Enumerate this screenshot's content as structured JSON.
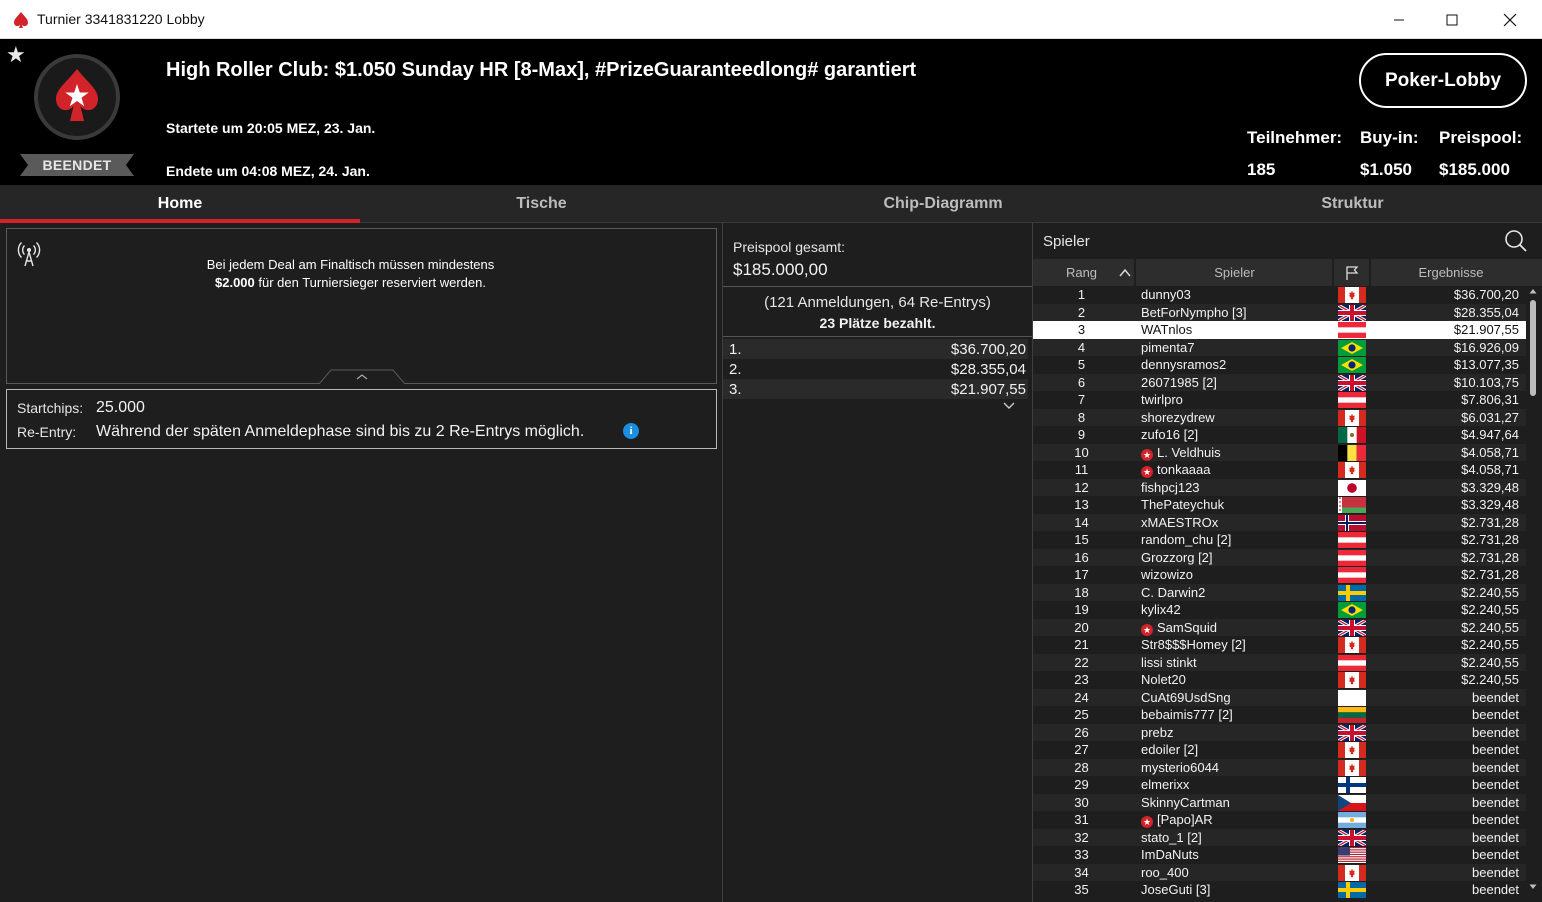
{
  "window": {
    "title": "Turnier 3341831220 Lobby"
  },
  "header": {
    "tournament_name": "High Roller Club: $1.050 Sunday HR [8-Max], #PrizeGuaranteedlong# garantiert",
    "started": "Startete um 20:05 MEZ, 23. Jan.",
    "ended": "Endete um 04:08 MEZ, 24. Jan.",
    "status": "BEENDET",
    "lobby_button": "Poker-Lobby",
    "stats": [
      {
        "label": "Teilnehmer:",
        "value": "185"
      },
      {
        "label": "Buy-in:",
        "value": "$1.050"
      },
      {
        "label": "Preispool:",
        "value": "$185.000"
      }
    ]
  },
  "tabs": [
    "Home",
    "Tische",
    "Chip-Diagramm",
    "Struktur"
  ],
  "active_tab": "Home",
  "home": {
    "notice_line1": "Bei jedem Deal am Finaltisch müssen mindestens",
    "notice_amount": "$2.000",
    "notice_line2_rest": " für den Turniersieger reserviert werden.",
    "startchips_label": "Startchips:",
    "startchips_value": "25.000",
    "reentry_label": "Re-Entry:",
    "reentry_value": "Während der späten Anmeldephase sind bis zu 2 Re-Entrys möglich.",
    "info_icon": "i"
  },
  "prizepool": {
    "label": "Preispool gesamt:",
    "value": "$185.000,00",
    "registrations": "(121 Anmeldungen, 64 Re-Entrys)",
    "paid_places": "23 Plätze bezahlt.",
    "prizes": [
      {
        "place": "1.",
        "amount": "$36.700,20"
      },
      {
        "place": "2.",
        "amount": "$28.355,04"
      },
      {
        "place": "3.",
        "amount": "$21.907,55"
      }
    ]
  },
  "players": {
    "search_label": "Spieler",
    "columns": {
      "rank": "Rang",
      "player": "Spieler",
      "result": "Ergebnisse"
    },
    "selected_rank": 3,
    "rows": [
      {
        "rank": "1",
        "name": "dunny03",
        "flag": "ca",
        "result": "$36.700,20",
        "pro": false
      },
      {
        "rank": "2",
        "name": "BetForNympho [3]",
        "flag": "gb",
        "result": "$28.355,04",
        "pro": false
      },
      {
        "rank": "3",
        "name": "WATnlos",
        "flag": "at",
        "result": "$21.907,55",
        "pro": false
      },
      {
        "rank": "4",
        "name": "pimenta7",
        "flag": "br",
        "result": "$16.926,09",
        "pro": false
      },
      {
        "rank": "5",
        "name": "dennysramos2",
        "flag": "br",
        "result": "$13.077,35",
        "pro": false
      },
      {
        "rank": "6",
        "name": "26071985 [2]",
        "flag": "gb",
        "result": "$10.103,75",
        "pro": false
      },
      {
        "rank": "7",
        "name": "twirlpro",
        "flag": "at",
        "result": "$7.806,31",
        "pro": false
      },
      {
        "rank": "8",
        "name": "shorezydrew",
        "flag": "ca",
        "result": "$6.031,27",
        "pro": false
      },
      {
        "rank": "9",
        "name": "zufo16 [2]",
        "flag": "mx",
        "result": "$4.947,64",
        "pro": false
      },
      {
        "rank": "10",
        "name": "L. Veldhuis",
        "flag": "be",
        "result": "$4.058,71",
        "pro": true
      },
      {
        "rank": "11",
        "name": "tonkaaaa",
        "flag": "ca",
        "result": "$4.058,71",
        "pro": true
      },
      {
        "rank": "12",
        "name": "fishpcj123",
        "flag": "jp",
        "result": "$3.329,48",
        "pro": false
      },
      {
        "rank": "13",
        "name": "ThePateychuk",
        "flag": "by",
        "result": "$3.329,48",
        "pro": false
      },
      {
        "rank": "14",
        "name": "xMAESTROx",
        "flag": "no",
        "result": "$2.731,28",
        "pro": false
      },
      {
        "rank": "15",
        "name": "random_chu [2]",
        "flag": "at",
        "result": "$2.731,28",
        "pro": false
      },
      {
        "rank": "16",
        "name": "Grozzorg [2]",
        "flag": "at",
        "result": "$2.731,28",
        "pro": false
      },
      {
        "rank": "17",
        "name": "wizowizo",
        "flag": "at",
        "result": "$2.731,28",
        "pro": false
      },
      {
        "rank": "18",
        "name": "C. Darwin2",
        "flag": "se",
        "result": "$2.240,55",
        "pro": false
      },
      {
        "rank": "19",
        "name": "kylix42",
        "flag": "br",
        "result": "$2.240,55",
        "pro": false
      },
      {
        "rank": "20",
        "name": "SamSquid",
        "flag": "gb",
        "result": "$2.240,55",
        "pro": true
      },
      {
        "rank": "21",
        "name": "Str8$$$Homey [2]",
        "flag": "ca",
        "result": "$2.240,55",
        "pro": false
      },
      {
        "rank": "22",
        "name": "lissi stinkt",
        "flag": "at",
        "result": "$2.240,55",
        "pro": false
      },
      {
        "rank": "23",
        "name": "Nolet20",
        "flag": "ca",
        "result": "$2.240,55",
        "pro": false
      },
      {
        "rank": "24",
        "name": "CuAt69UsdSng",
        "flag": "blank",
        "result": "beendet",
        "pro": false
      },
      {
        "rank": "25",
        "name": "bebaimis777 [2]",
        "flag": "lt",
        "result": "beendet",
        "pro": false
      },
      {
        "rank": "26",
        "name": "prebz",
        "flag": "gb",
        "result": "beendet",
        "pro": false
      },
      {
        "rank": "27",
        "name": "edoiler [2]",
        "flag": "ca",
        "result": "beendet",
        "pro": false
      },
      {
        "rank": "28",
        "name": "mysterio6044",
        "flag": "ca",
        "result": "beendet",
        "pro": false
      },
      {
        "rank": "29",
        "name": "elmerixx",
        "flag": "fi",
        "result": "beendet",
        "pro": false
      },
      {
        "rank": "30",
        "name": "SkinnyCartman",
        "flag": "cz",
        "result": "beendet",
        "pro": false
      },
      {
        "rank": "31",
        "name": "[Papo]AR",
        "flag": "ar",
        "result": "beendet",
        "pro": true
      },
      {
        "rank": "32",
        "name": "stato_1 [2]",
        "flag": "gb",
        "result": "beendet",
        "pro": false
      },
      {
        "rank": "33",
        "name": "ImDaNuts",
        "flag": "us",
        "result": "beendet",
        "pro": false
      },
      {
        "rank": "34",
        "name": "roo_400",
        "flag": "ca",
        "result": "beendet",
        "pro": false
      },
      {
        "rank": "35",
        "name": "JoseGuti [3]",
        "flag": "se",
        "result": "beendet",
        "pro": false
      }
    ]
  },
  "colors": {
    "accent": "#d2232a",
    "background": "#1e1e1e",
    "header_bg": "#000000",
    "info": "#1a8fe0"
  }
}
